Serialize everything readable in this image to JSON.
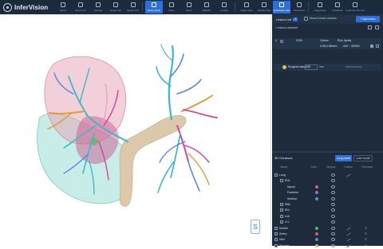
{
  "app": {
    "name": "InferVision"
  },
  "toolbar": {
    "tools": [
      {
        "label": "Series",
        "active": false
      },
      {
        "label": "Study List",
        "active": false
      },
      {
        "label": "Sample",
        "active": false
      },
      {
        "label": "Export NII",
        "active": false
      },
      {
        "label": "Export STL",
        "active": false
      },
      {
        "label": "Basic Scroll",
        "active": true
      },
      {
        "label": "Move",
        "active": false
      },
      {
        "label": "Zoom",
        "active": false
      },
      {
        "label": "WW/WL",
        "active": false
      },
      {
        "label": "Length",
        "active": false
      },
      {
        "label": "Single View",
        "active": false
      },
      {
        "label": "Double View",
        "active": false
      },
      {
        "label": "Quadruple View",
        "active": true
      },
      {
        "label": "Full-screen",
        "active": false
      },
      {
        "label": "Trajectories",
        "active": false
      },
      {
        "label": "Feedback",
        "active": false
      },
      {
        "label": "Customer Service",
        "active": false
      }
    ]
  },
  "viewport": {
    "orientation_marker": {
      "top": "- - -",
      "letter": "S"
    }
  },
  "lesions": {
    "tab_label": "Lesion List",
    "count": "1",
    "show_filter_label": "Show 6.0mm nodules",
    "add_button": "+ Add lesion",
    "detected_label": "1 lesions detected",
    "row": {
      "index": "1",
      "type": "GGN",
      "size": "3.6mm",
      "location": "RUL Apical",
      "volume": "0.06,0.05mm³",
      "hu_range": "-423 ~ 320HU"
    },
    "surgical_margin": {
      "label": "Surgical margin",
      "value": "20",
      "unit": "mm",
      "transparency_label": "transparency"
    }
  },
  "contours": {
    "title": "3D Contours",
    "modes": [
      "Lung mode",
      "Lobe mode"
    ],
    "columns": [
      "Name",
      "Color",
      "Display",
      "Outline",
      "Freeview"
    ],
    "rows": [
      {
        "name": "Lung",
        "level": 0,
        "color": ""
      },
      {
        "name": "RUL",
        "level": 1,
        "color": ""
      },
      {
        "name": "Apical",
        "level": 2,
        "color": "#d9608f"
      },
      {
        "name": "Posterior",
        "level": 2,
        "color": "#9b6fc9"
      },
      {
        "name": "Anterior",
        "level": 2,
        "color": "#3f9bd6"
      },
      {
        "name": "RML",
        "level": 1,
        "color": ""
      },
      {
        "name": "RLL",
        "level": 1,
        "color": ""
      },
      {
        "name": "LUL",
        "level": 1,
        "color": ""
      },
      {
        "name": "LLL",
        "level": 1,
        "color": ""
      },
      {
        "name": "Nodule",
        "level": 0,
        "color": "#4fc14a"
      },
      {
        "name": "Artery",
        "level": 0,
        "color": "#d95b6f"
      },
      {
        "name": "Vein",
        "level": 0,
        "color": "#4d8fe0"
      },
      {
        "name": "Trachea",
        "level": 0,
        "color": "#d9b84a"
      }
    ]
  },
  "colors": {
    "toolbar": "#1c2a3e",
    "panel": "#1d2b3d",
    "accent": "#2f6fd8",
    "trachea": "#dcc8ab",
    "lobe_pink": "#e6a2b6",
    "lobe_teal": "#9bdcd6",
    "airway_teal": "#3fb7c9",
    "airway_orange": "#e59a3a",
    "airway_magenta": "#d048a0",
    "airway_blue": "#5a86d8"
  }
}
